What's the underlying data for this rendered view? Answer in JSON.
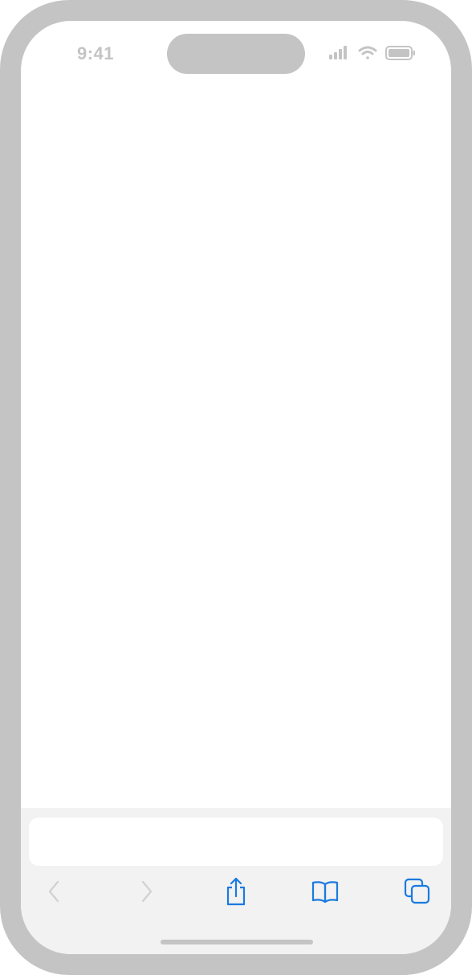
{
  "status_bar": {
    "time": "9:41",
    "icons": [
      "cellular-signal-icon",
      "wifi-icon",
      "battery-icon"
    ]
  },
  "browser": {
    "address_bar": {
      "value": "",
      "placeholder": ""
    },
    "toolbar": {
      "buttons": [
        {
          "name": "back",
          "icon": "chevron-left-icon",
          "enabled": false
        },
        {
          "name": "forward",
          "icon": "chevron-right-icon",
          "enabled": false
        },
        {
          "name": "share",
          "icon": "share-icon",
          "enabled": true
        },
        {
          "name": "bookmarks",
          "icon": "book-icon",
          "enabled": true
        },
        {
          "name": "tabs",
          "icon": "tabs-icon",
          "enabled": true
        }
      ]
    }
  },
  "colors": {
    "frame": "#c4c4c4",
    "toolbar_bg": "#f2f2f2",
    "accent": "#1a7ae0",
    "disabled": "#d2d2d2"
  }
}
